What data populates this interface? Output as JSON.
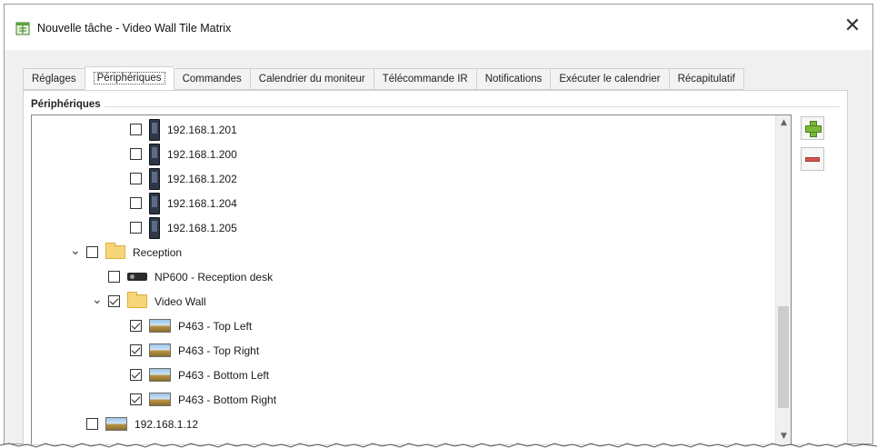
{
  "window": {
    "title": "Nouvelle tâche - Video Wall Tile Matrix",
    "close_glyph": "✕"
  },
  "tabs": [
    {
      "label": "Réglages",
      "active": false
    },
    {
      "label": "Périphériques",
      "active": true
    },
    {
      "label": "Commandes",
      "active": false
    },
    {
      "label": "Calendrier du moniteur",
      "active": false
    },
    {
      "label": "Télécommande IR",
      "active": false
    },
    {
      "label": "Notifications",
      "active": false
    },
    {
      "label": "Exécuter le calendrier",
      "active": false
    },
    {
      "label": "Récapitulatif",
      "active": false
    }
  ],
  "panel": {
    "group_title": "Périphériques"
  },
  "tree": [
    {
      "label": "192.168.1.201",
      "icon": "display-icon",
      "checked": false,
      "level": 3,
      "expander": ""
    },
    {
      "label": "192.168.1.200",
      "icon": "display-icon",
      "checked": false,
      "level": 3,
      "expander": ""
    },
    {
      "label": "192.168.1.202",
      "icon": "display-icon",
      "checked": false,
      "level": 3,
      "expander": ""
    },
    {
      "label": "192.168.1.204",
      "icon": "display-icon",
      "checked": false,
      "level": 3,
      "expander": ""
    },
    {
      "label": "192.168.1.205",
      "icon": "display-icon",
      "checked": false,
      "level": 3,
      "expander": ""
    },
    {
      "label": "Reception",
      "icon": "folder-icon",
      "checked": false,
      "level": 1,
      "expander": "expanded"
    },
    {
      "label": "NP600 - Reception desk",
      "icon": "projector-icon",
      "checked": false,
      "level": 2,
      "expander": ""
    },
    {
      "label": "Video Wall",
      "icon": "folder-icon",
      "checked": true,
      "level": 2,
      "expander": "expanded"
    },
    {
      "label": "P463 - Top Left",
      "icon": "landscape-display-icon",
      "checked": true,
      "level": 3,
      "expander": ""
    },
    {
      "label": "P463 - Top Right",
      "icon": "landscape-display-icon",
      "checked": true,
      "level": 3,
      "expander": ""
    },
    {
      "label": "P463 - Bottom Left",
      "icon": "landscape-display-icon",
      "checked": true,
      "level": 3,
      "expander": ""
    },
    {
      "label": "P463 - Bottom Right",
      "icon": "landscape-display-icon",
      "checked": true,
      "level": 3,
      "expander": ""
    },
    {
      "label": "192.168.1.12",
      "icon": "landscape-display-icon",
      "checked": false,
      "level": 1,
      "expander": ""
    }
  ],
  "scrollbar": {
    "up_glyph": "▲",
    "down_glyph": "▼"
  },
  "colors": {
    "add_button": "#79b83a",
    "remove_button": "#d9534f",
    "folder": "#f7d67a"
  }
}
